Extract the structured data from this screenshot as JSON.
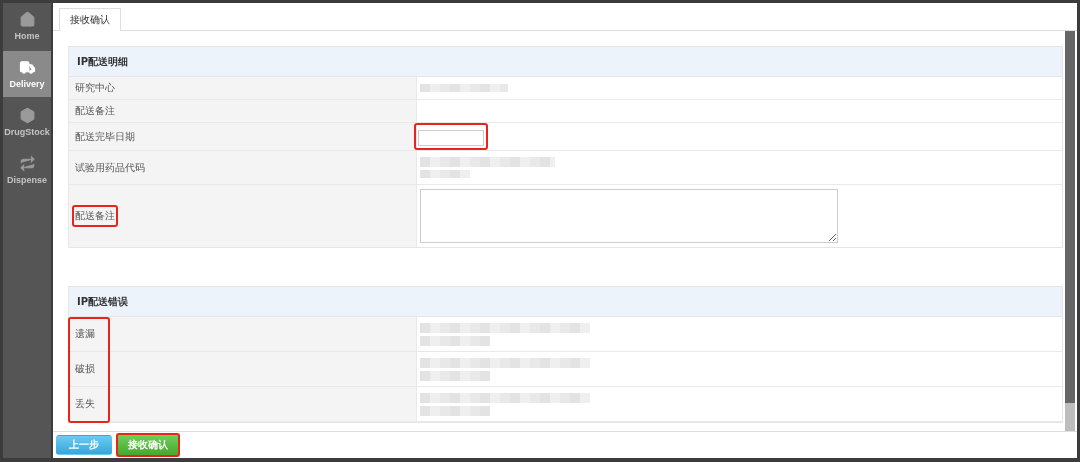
{
  "sidebar": {
    "items": [
      {
        "label": "Home",
        "selected": false
      },
      {
        "label": "Delivery",
        "selected": true
      },
      {
        "label": "DrugStock",
        "selected": false
      },
      {
        "label": "Dispense",
        "selected": false
      }
    ]
  },
  "tabs": [
    {
      "label": "接收确认",
      "selected": true
    }
  ],
  "sections": [
    {
      "title": "IP配送明细",
      "labels_highlighted": false,
      "rows": [
        {
          "label": "研究中心",
          "kind": "redacted",
          "highlighted": false
        },
        {
          "label": "配送备注",
          "kind": "empty",
          "highlighted": false
        },
        {
          "label": "配送完毕日期",
          "kind": "date",
          "highlighted": true
        },
        {
          "label": "试验用药品代码",
          "kind": "redacted2",
          "highlighted": false
        },
        {
          "label": "配送备注",
          "kind": "textarea",
          "highlighted": true
        }
      ]
    },
    {
      "title": "IP配送错误",
      "labels_highlighted": true,
      "rows": [
        {
          "label": "遗漏",
          "kind": "redacted3",
          "highlighted": false
        },
        {
          "label": "破损",
          "kind": "redacted3",
          "highlighted": false
        },
        {
          "label": "丢失",
          "kind": "redacted3",
          "highlighted": false
        }
      ]
    }
  ],
  "buttons": [
    {
      "label": "上一步",
      "kind": "back",
      "highlighted": false
    },
    {
      "label": "接收确认",
      "kind": "confirm",
      "highlighted": true
    }
  ]
}
